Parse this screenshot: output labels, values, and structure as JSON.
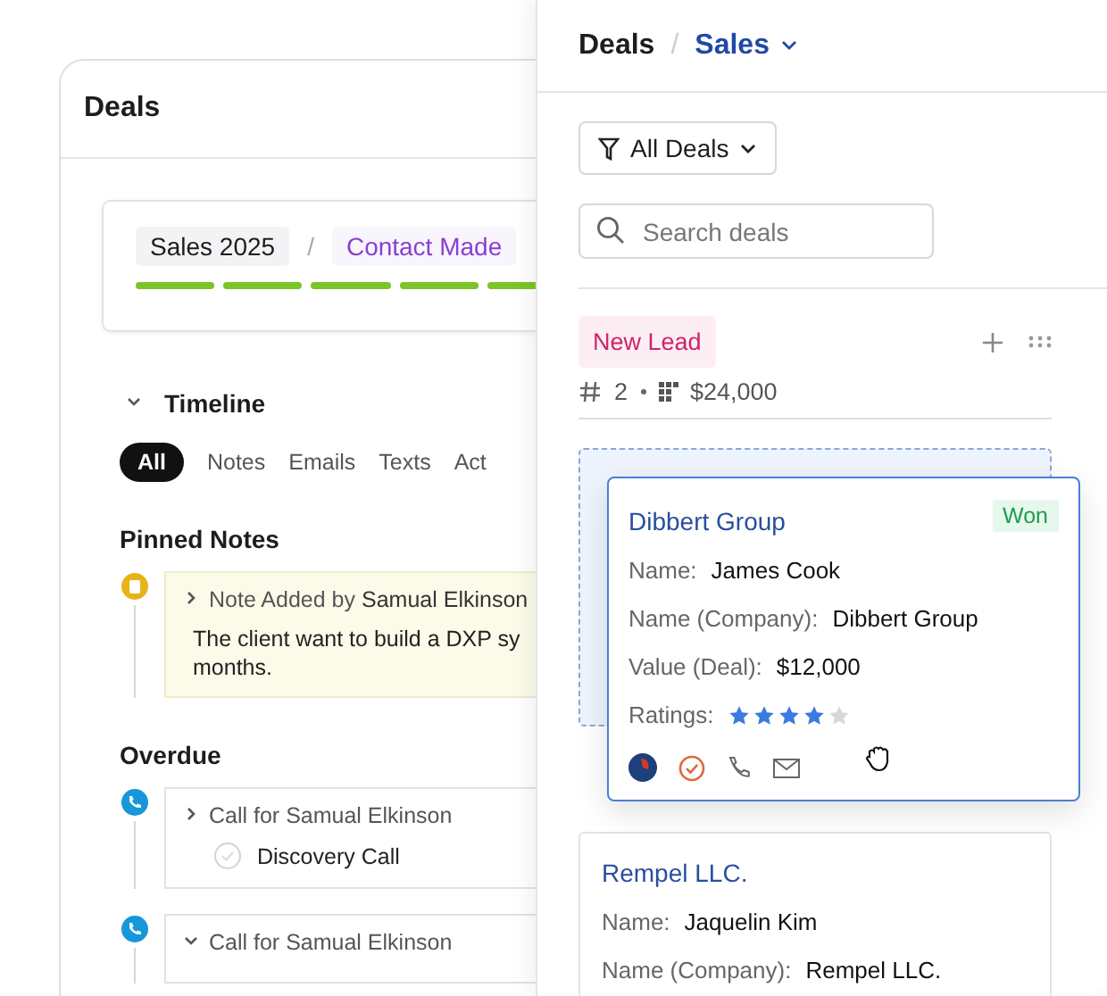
{
  "left_window": {
    "title": "Deals",
    "pipeline": {
      "name": "Sales 2025",
      "separator": "/",
      "stage": "Contact Made"
    },
    "timeline": {
      "title": "Timeline",
      "expanded": true,
      "tabs": [
        {
          "label": "All",
          "selected": true
        },
        {
          "label": "Notes",
          "selected": false
        },
        {
          "label": "Emails",
          "selected": false
        },
        {
          "label": "Texts",
          "selected": false
        },
        {
          "label": "Act",
          "selected": false
        }
      ]
    },
    "sections": [
      {
        "title": "Pinned Notes",
        "items": [
          {
            "kind": "note",
            "heading_prefix": "Note Added by",
            "author": "Samual Elkinson",
            "expanded": false,
            "lines": [
              "The client want to build a DXP sy",
              "months."
            ]
          }
        ]
      },
      {
        "title": "Overdue",
        "items": [
          {
            "kind": "call",
            "heading": "Call for Samual Elkinson",
            "expanded": false,
            "task": "Discovery Call",
            "done": false
          },
          {
            "kind": "call",
            "heading": "Call for Samual Elkinson",
            "expanded": true
          }
        ]
      }
    ]
  },
  "right_panel": {
    "breadcrumb": {
      "root": "Deals",
      "separator": "/",
      "current": "Sales"
    },
    "filter": {
      "label": "All Deals"
    },
    "search": {
      "placeholder": "Search deals"
    },
    "column": {
      "name": "New Lead",
      "count": "2",
      "total": "$24,000",
      "cards": [
        {
          "title": "Dibbert Group",
          "status": "Won",
          "dragging": true,
          "fields": [
            {
              "label": "Name:",
              "value": "James Cook"
            },
            {
              "label": "Name (Company):",
              "value": "Dibbert Group"
            },
            {
              "label": "Value (Deal):",
              "value": "$12,000"
            }
          ],
          "rating_label": "Ratings:",
          "stars": 4
        },
        {
          "title": "Rempel LLC.",
          "dragging": false,
          "fields": [
            {
              "label": "Name:",
              "value": "Jaquelin Kim"
            },
            {
              "label": "Name (Company):",
              "value": "Rempel LLC."
            }
          ]
        }
      ]
    }
  }
}
